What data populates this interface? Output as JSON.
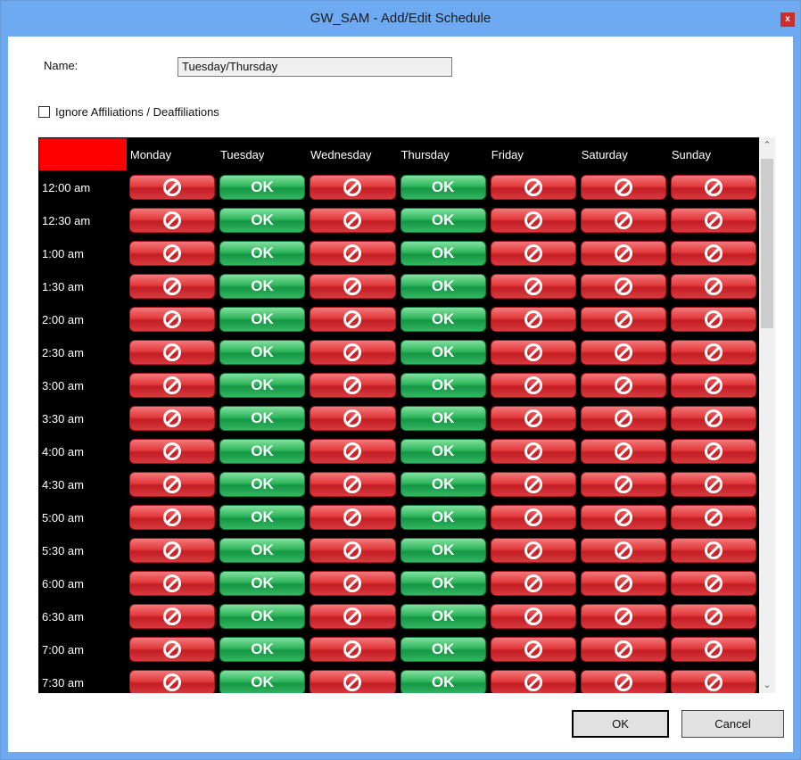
{
  "window": {
    "title": "GW_SAM - Add/Edit Schedule",
    "close_glyph": "x"
  },
  "form": {
    "name_label": "Name:",
    "name_value": "Tuesday/Thursday",
    "checkbox_label": "Ignore Affiliations / Deaffiliations",
    "checkbox_checked": false
  },
  "schedule": {
    "days": [
      "Monday",
      "Tuesday",
      "Wednesday",
      "Thursday",
      "Friday",
      "Saturday",
      "Sunday"
    ],
    "times": [
      "12:00 am",
      "12:30 am",
      "1:00 am",
      "1:30 am",
      "2:00 am",
      "2:30 am",
      "3:00 am",
      "3:30 am",
      "4:00 am",
      "4:30 am",
      "5:00 am",
      "5:30 am",
      "6:00 am",
      "6:30 am",
      "7:00 am",
      "7:30 am"
    ],
    "allowed_days": [
      "Tuesday",
      "Thursday"
    ],
    "allow_label": "OK",
    "deny_icon": "no-entry-icon",
    "colors": {
      "corner": "#ff0000",
      "deny": "#e53a3c",
      "allow": "#2fb65c"
    }
  },
  "buttons": {
    "ok_label": "OK",
    "cancel_label": "Cancel"
  }
}
